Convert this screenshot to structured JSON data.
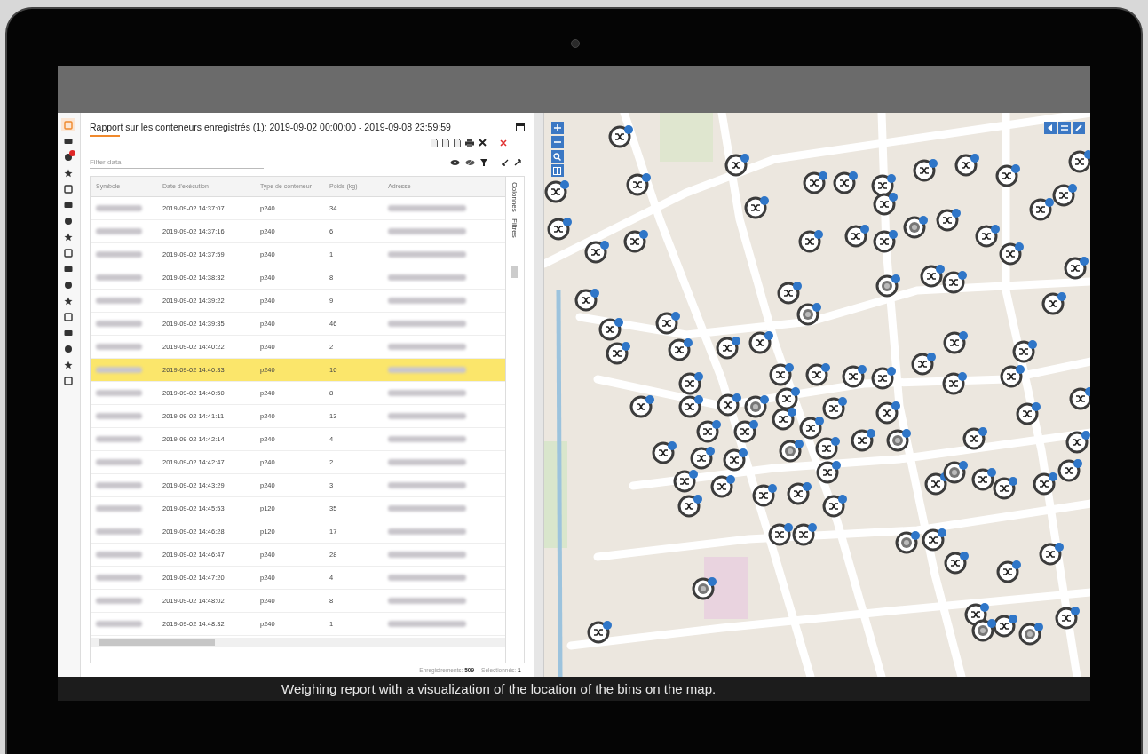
{
  "sidebar": {
    "items": [
      {
        "selected": true,
        "notification": false
      },
      {
        "selected": false,
        "notification": false
      },
      {
        "selected": false,
        "notification": true
      },
      {
        "selected": false,
        "notification": false
      },
      {
        "selected": false,
        "notification": false
      },
      {
        "selected": false,
        "notification": false
      },
      {
        "selected": false,
        "notification": false
      },
      {
        "selected": false,
        "notification": false
      },
      {
        "selected": false,
        "notification": false
      },
      {
        "selected": false,
        "notification": false
      },
      {
        "selected": false,
        "notification": false
      },
      {
        "selected": false,
        "notification": false
      },
      {
        "selected": false,
        "notification": false
      },
      {
        "selected": false,
        "notification": false
      },
      {
        "selected": false,
        "notification": false
      },
      {
        "selected": false,
        "notification": false
      },
      {
        "selected": false,
        "notification": false
      }
    ]
  },
  "panel": {
    "title": "Rapport sur les conteneurs enregistrés (1): 2019-09-02 00:00:00 - 2019-09-08 23:59:59",
    "filter": {
      "placeholder": "Filter data"
    },
    "side_tabs": [
      "Colonnes",
      "Filtres"
    ]
  },
  "table": {
    "columns": [
      "Symbole",
      "Date d'exécution",
      "Type de conteneur",
      "Poids (kg)",
      "Adresse"
    ],
    "rows": [
      {
        "date": "2019-09-02 14:37:07",
        "type": "p240",
        "weight": "34",
        "selected": false
      },
      {
        "date": "2019-09-02 14:37:16",
        "type": "p240",
        "weight": "6",
        "selected": false
      },
      {
        "date": "2019-09-02 14:37:59",
        "type": "p240",
        "weight": "1",
        "selected": false
      },
      {
        "date": "2019-09-02 14:38:32",
        "type": "p240",
        "weight": "8",
        "selected": false
      },
      {
        "date": "2019-09-02 14:39:22",
        "type": "p240",
        "weight": "9",
        "selected": false
      },
      {
        "date": "2019-09-02 14:39:35",
        "type": "p240",
        "weight": "46",
        "selected": false
      },
      {
        "date": "2019-09-02 14:40:22",
        "type": "p240",
        "weight": "2",
        "selected": false
      },
      {
        "date": "2019-09-02 14:40:33",
        "type": "p240",
        "weight": "10",
        "selected": true
      },
      {
        "date": "2019-09-02 14:40:50",
        "type": "p240",
        "weight": "8",
        "selected": false
      },
      {
        "date": "2019-09-02 14:41:11",
        "type": "p240",
        "weight": "13",
        "selected": false
      },
      {
        "date": "2019-09-02 14:42:14",
        "type": "p240",
        "weight": "4",
        "selected": false
      },
      {
        "date": "2019-09-02 14:42:47",
        "type": "p240",
        "weight": "2",
        "selected": false
      },
      {
        "date": "2019-09-02 14:43:29",
        "type": "p240",
        "weight": "3",
        "selected": false
      },
      {
        "date": "2019-09-02 14:45:53",
        "type": "p120",
        "weight": "35",
        "selected": false
      },
      {
        "date": "2019-09-02 14:46:28",
        "type": "p120",
        "weight": "17",
        "selected": false
      },
      {
        "date": "2019-09-02 14:46:47",
        "type": "p240",
        "weight": "28",
        "selected": false
      },
      {
        "date": "2019-09-02 14:47:20",
        "type": "p240",
        "weight": "4",
        "selected": false
      },
      {
        "date": "2019-09-02 14:48:02",
        "type": "p240",
        "weight": "8",
        "selected": false
      },
      {
        "date": "2019-09-02 14:48:32",
        "type": "p240",
        "weight": "1",
        "selected": false
      }
    ]
  },
  "status_bar": {
    "records": "Enregistrements: **509**",
    "selected": "Sélectionnés: **1**"
  },
  "caption": "Weighing report with a visualization of the location of the bins on the map."
}
